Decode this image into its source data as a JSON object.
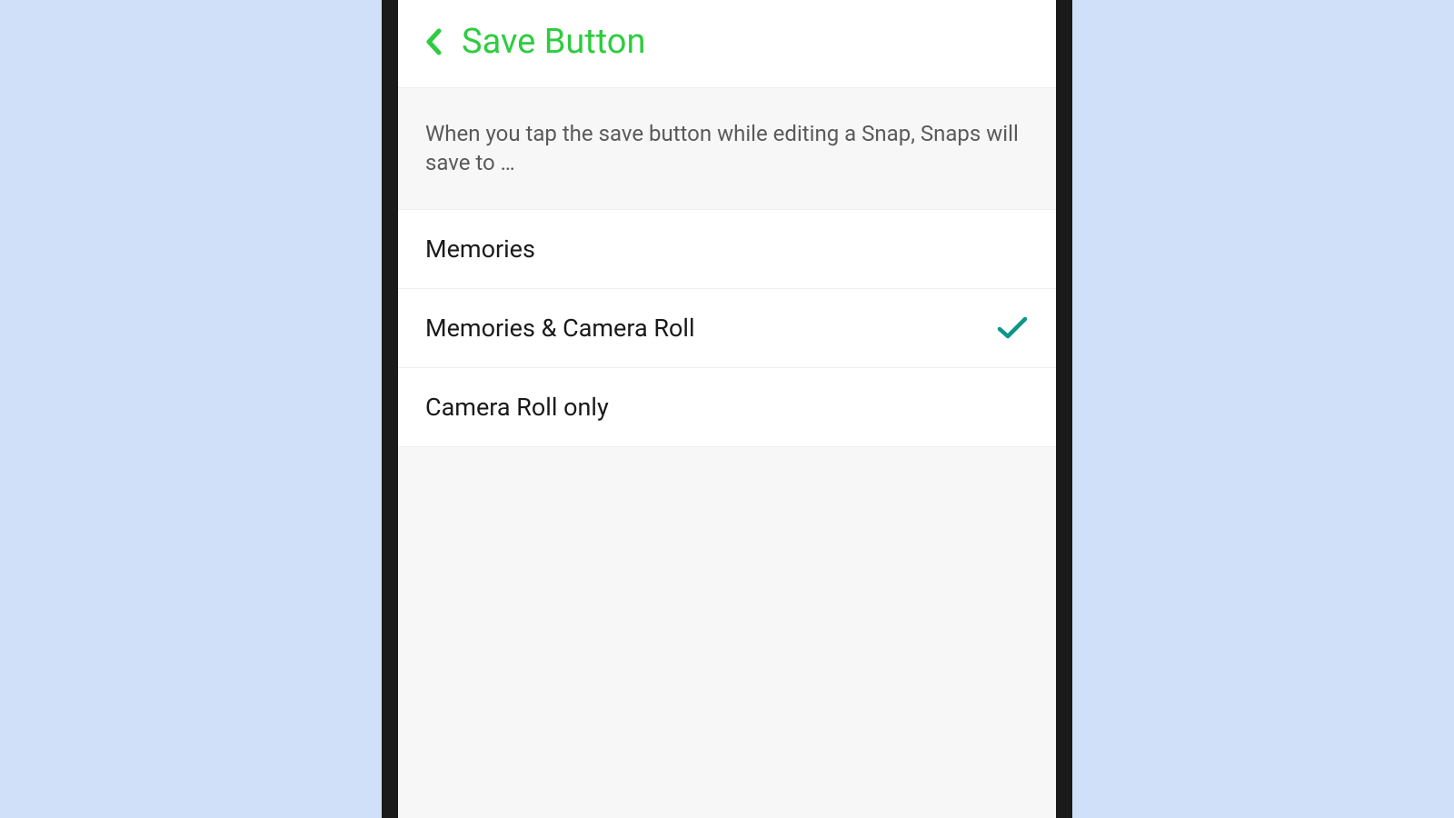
{
  "header": {
    "title": "Save Button"
  },
  "description": "When you tap the save button while editing a Snap, Snaps will save to …",
  "options": [
    {
      "label": "Memories",
      "selected": false
    },
    {
      "label": "Memories & Camera Roll",
      "selected": true
    },
    {
      "label": "Camera Roll only",
      "selected": false
    }
  ],
  "colors": {
    "accent": "#2ecc40",
    "checkmark": "#0a9688"
  }
}
